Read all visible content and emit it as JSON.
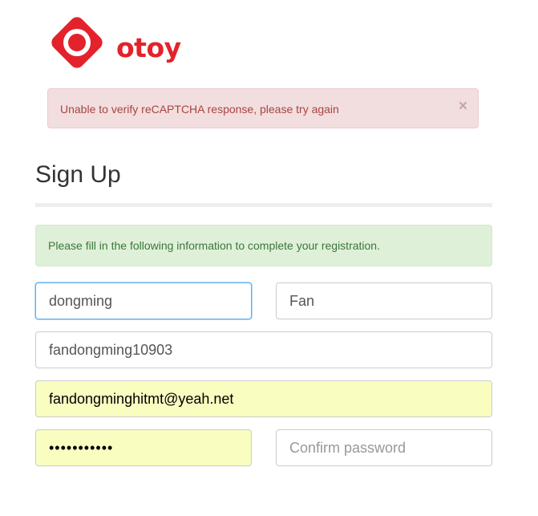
{
  "brand": {
    "name": "otoy",
    "color": "#e3222b"
  },
  "alert_error": {
    "message": "Unable to verify reCAPTCHA response, please try again",
    "close_label": "×"
  },
  "page_title": "Sign Up",
  "alert_info": {
    "message": "Please fill in the following information to complete your registration."
  },
  "form": {
    "first_name": {
      "value": "dongming",
      "placeholder": ""
    },
    "last_name": {
      "value": "Fan",
      "placeholder": ""
    },
    "username": {
      "value": "fandongming10903",
      "placeholder": ""
    },
    "email": {
      "value": "fandongminghitmt@yeah.net",
      "placeholder": ""
    },
    "password": {
      "value": "12345678901",
      "placeholder": ""
    },
    "confirm_password": {
      "value": "",
      "placeholder": "Confirm password"
    }
  }
}
